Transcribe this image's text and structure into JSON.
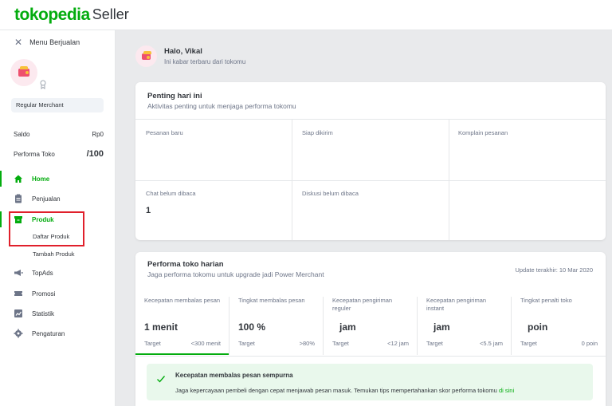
{
  "header": {
    "logo_main": "tokopedia",
    "logo_sub": "Seller"
  },
  "sidebar": {
    "menu_label": "Menu Berjualan",
    "merchant_type": "Regular Merchant",
    "saldo_label": "Saldo",
    "saldo_value": "Rp0",
    "performa_label": "Performa Toko",
    "performa_value": "/100",
    "nav": [
      {
        "label": "Home",
        "icon": "home-icon"
      },
      {
        "label": "Penjualan",
        "icon": "clipboard-icon"
      },
      {
        "label": "Produk",
        "icon": "box-icon"
      },
      {
        "label": "TopAds",
        "icon": "megaphone-icon"
      },
      {
        "label": "Promosi",
        "icon": "ticket-icon"
      },
      {
        "label": "Statistik",
        "icon": "chart-icon"
      },
      {
        "label": "Pengaturan",
        "icon": "gear-icon"
      }
    ],
    "produk_sub": [
      "Daftar Produk",
      "Tambah Produk"
    ]
  },
  "greeting": {
    "title": "Halo, Vikal",
    "subtitle": "Ini kabar terbaru dari tokomu"
  },
  "important": {
    "title": "Penting hari ini",
    "subtitle": "Aktivitas penting untuk menjaga performa tokomu",
    "cells": [
      {
        "label": "Pesanan baru",
        "value": ""
      },
      {
        "label": "Siap dikirim",
        "value": ""
      },
      {
        "label": "Komplain pesanan",
        "value": ""
      },
      {
        "label": "Chat belum dibaca",
        "value": "1"
      },
      {
        "label": "Diskusi belum dibaca",
        "value": ""
      }
    ]
  },
  "performance": {
    "title": "Performa toko harian",
    "subtitle": "Jaga performa tokomu untuk upgrade jadi Power Merchant",
    "updated": "Update terakhir: 10 Mar 2020",
    "target_label": "Target",
    "metrics": [
      {
        "label": "Kecepatan membalas pesan",
        "value": "1 menit",
        "target": "<300 menit"
      },
      {
        "label": "Tingkat membalas pesan",
        "value": "100 %",
        "target": ">80%"
      },
      {
        "label": "Kecepatan pengiriman reguler",
        "value": "jam",
        "target": "<12 jam"
      },
      {
        "label": "Kecepatan pengiriman instant",
        "value": "jam",
        "target": "<5.5 jam"
      },
      {
        "label": "Tingkat penalti toko",
        "value": "poin",
        "target": "0 poin"
      }
    ],
    "alert_title": "Kecepatan membalas pesan sempurna",
    "alert_text": "Jaga kepercayaan pembeli dengan cepat menjawab pesan masuk. Temukan tips mempertahankan skor performa tokomu ",
    "alert_link": "di sini"
  },
  "colors": {
    "brand": "#03ac0e",
    "highlight_box": "#e0202b"
  }
}
